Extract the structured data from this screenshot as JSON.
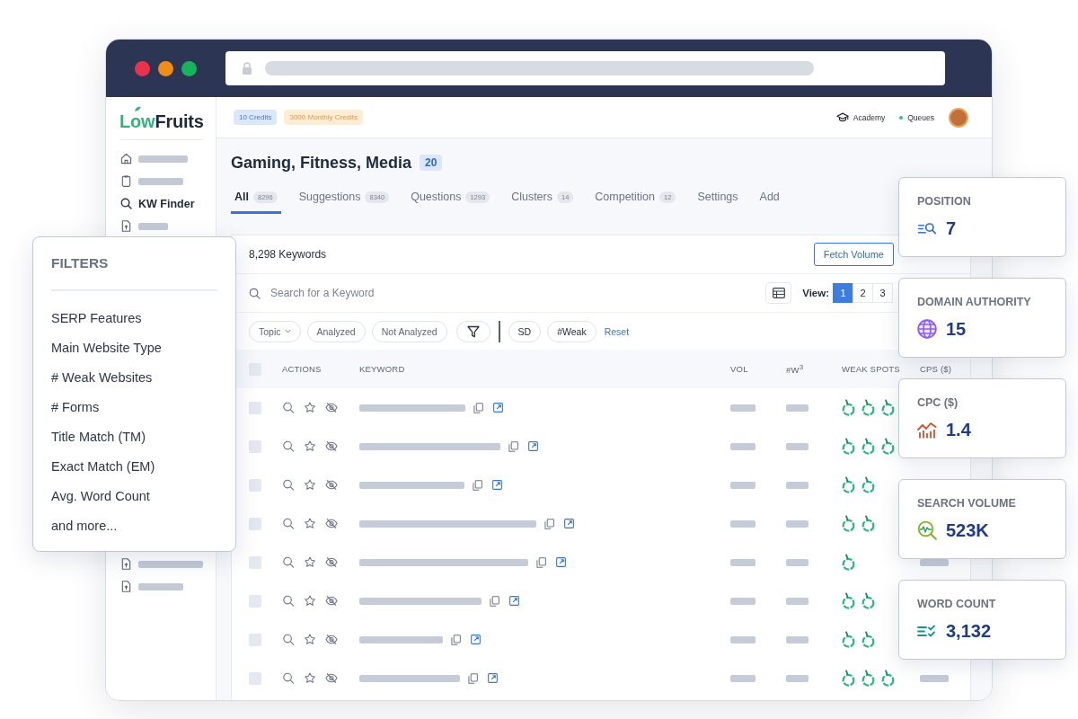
{
  "browser": {
    "dots": [
      {
        "color": "#e8334a"
      },
      {
        "color": "#f28c18"
      },
      {
        "color": "#17b35d"
      }
    ]
  },
  "sidebar": {
    "logo": {
      "accent": "Low",
      "rest": "Fruits"
    },
    "items": [
      {
        "kind": "placeholder"
      },
      {
        "kind": "placeholder"
      },
      {
        "kind": "link",
        "label": "KW Finder"
      },
      {
        "kind": "placeholder"
      }
    ],
    "lower_items": [
      {
        "kind": "placeholder"
      },
      {
        "kind": "placeholder"
      }
    ]
  },
  "topbar": {
    "credits": [
      {
        "kind": "plan",
        "label": "10 Credits"
      },
      {
        "kind": "monthly",
        "label": "3000 Monthly Credits"
      }
    ],
    "links": [
      {
        "kind": "academy",
        "label": "Academy"
      },
      {
        "kind": "queues",
        "label": "Queues"
      }
    ]
  },
  "project": {
    "title": "Gaming, Fitness, Media",
    "count": "20"
  },
  "tabs": [
    {
      "label": "All",
      "count": "8296",
      "selected": true
    },
    {
      "label": "Suggestions",
      "count": "8340",
      "selected": false
    },
    {
      "label": "Questions",
      "count": "1293",
      "selected": false
    },
    {
      "label": "Clusters",
      "count": "14",
      "selected": false
    },
    {
      "label": "Competition",
      "count": "12",
      "selected": false
    },
    {
      "label": "Settings",
      "selected": false
    },
    {
      "label": "Add",
      "selected": false
    }
  ],
  "results": {
    "count_label": "8,298 Keywords",
    "fetch_button": "Fetch Volume"
  },
  "search": {
    "placeholder": "Search for a Keyword"
  },
  "view": {
    "label": "View:",
    "options": [
      {
        "label": "1",
        "selected": true
      },
      {
        "label": "2",
        "selected": false
      },
      {
        "label": "3",
        "selected": false
      }
    ]
  },
  "filter_chips": [
    {
      "kind": "dropdown",
      "label": "Topic"
    },
    {
      "kind": "chip",
      "label": "Analyzed"
    },
    {
      "kind": "chip",
      "label": "Not Analyzed"
    },
    {
      "kind": "funnel"
    },
    {
      "kind": "divider"
    },
    {
      "kind": "chip",
      "label": "SD"
    },
    {
      "kind": "chip",
      "label": "#Weak"
    },
    {
      "kind": "link",
      "label": "Reset"
    }
  ],
  "table": {
    "select_all_checked": false,
    "columns": [
      "ACTIONS",
      "KEYWORD",
      "VOL",
      "#W$^{3}$",
      "WEAK SPOTS",
      "CPS ($)"
    ],
    "rows": [
      {
        "checked": false,
        "cps_visible": false,
        "weak_spots": [
          {
            "kind": "fruit"
          },
          {
            "kind": "fruit"
          },
          {
            "kind": "fruit"
          }
        ]
      },
      {
        "checked": false,
        "cps_visible": false,
        "weak_spots": [
          {
            "kind": "fruit"
          },
          {
            "kind": "fruit"
          },
          {
            "kind": "fruit"
          }
        ]
      },
      {
        "checked": false,
        "cps_visible": false,
        "weak_spots": [
          {
            "kind": "fruit"
          },
          {
            "kind": "fruit"
          }
        ]
      },
      {
        "checked": false,
        "cps_visible": false,
        "weak_spots": [
          {
            "kind": "fruit"
          },
          {
            "kind": "fruit"
          }
        ]
      },
      {
        "checked": false,
        "cps_visible": true,
        "weak_spots": [
          {
            "kind": "fruit"
          }
        ]
      },
      {
        "checked": false,
        "cps_visible": false,
        "weak_spots": [
          {
            "kind": "fruit"
          },
          {
            "kind": "fruit"
          }
        ]
      },
      {
        "checked": false,
        "cps_visible": false,
        "weak_spots": [
          {
            "kind": "fruit"
          },
          {
            "kind": "fruit"
          }
        ]
      },
      {
        "checked": false,
        "cps_visible": true,
        "weak_spots": [
          {
            "kind": "fruit"
          },
          {
            "kind": "fruit"
          },
          {
            "kind": "fruit"
          }
        ]
      }
    ]
  },
  "filters_panel": {
    "title": "FILTERS",
    "items": [
      "SERP Features",
      "Main Website Type",
      "# Weak Websites",
      "# Forms",
      "Title Match (TM)",
      "Exact Match (EM)",
      "Avg. Word Count",
      "and more..."
    ]
  },
  "stat_cards": [
    {
      "label": "POSITION",
      "value": "7"
    },
    {
      "label": "DOMAIN AUTHORITY",
      "value": "15"
    },
    {
      "label": "CPC ($)",
      "value": "1.4"
    },
    {
      "label": "SEARCH VOLUME",
      "value": "523K"
    },
    {
      "label": "WORD COUNT",
      "value": "3,132"
    }
  ]
}
